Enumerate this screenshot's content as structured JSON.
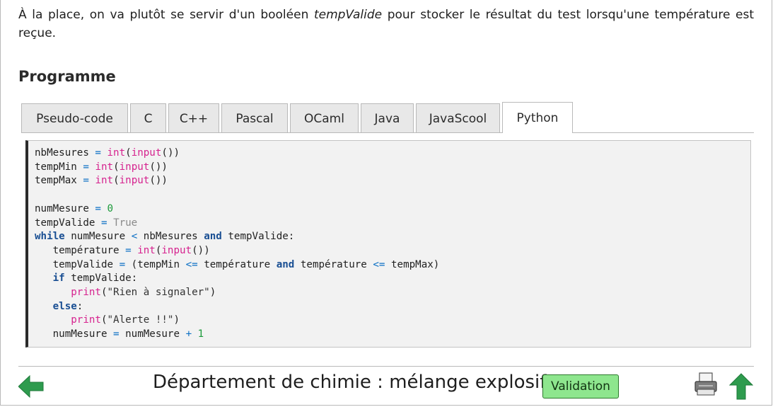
{
  "intro": {
    "before": "À la place, on va plutôt se servir d'un booléen ",
    "emphasis": "tempValide",
    "after": " pour stocker le résultat du test lorsqu'une température est reçue."
  },
  "section_title": "Programme",
  "tabs": [
    {
      "label": "Pseudo-code"
    },
    {
      "label": "C"
    },
    {
      "label": "C++"
    },
    {
      "label": "Pascal"
    },
    {
      "label": "OCaml"
    },
    {
      "label": "Java"
    },
    {
      "label": "JavaScool"
    },
    {
      "label": "Python"
    }
  ],
  "active_tab": "Python",
  "code_lines": [
    "nbMesures = int(input())",
    "tempMin = int(input())",
    "tempMax = int(input())",
    "",
    "numMesure = 0",
    "tempValide = True",
    "while numMesure < nbMesures and tempValide:",
    "   température = int(input())",
    "   tempValide = (tempMin <= température and température <= tempMax)",
    "   if tempValide:",
    "      print(\"Rien à signaler\")",
    "   else:",
    "      print(\"Alerte !!\")",
    "   numMesure = numMesure + 1"
  ],
  "footer": {
    "title": "Département de chimie : mélange explosif",
    "validation_label": "Validation",
    "back_icon": "arrow-left-icon",
    "print_icon": "printer-icon",
    "up_icon": "arrow-up-icon"
  },
  "colors": {
    "accent_green": "#2e9b4e",
    "validation_bg": "#8ee68e"
  }
}
